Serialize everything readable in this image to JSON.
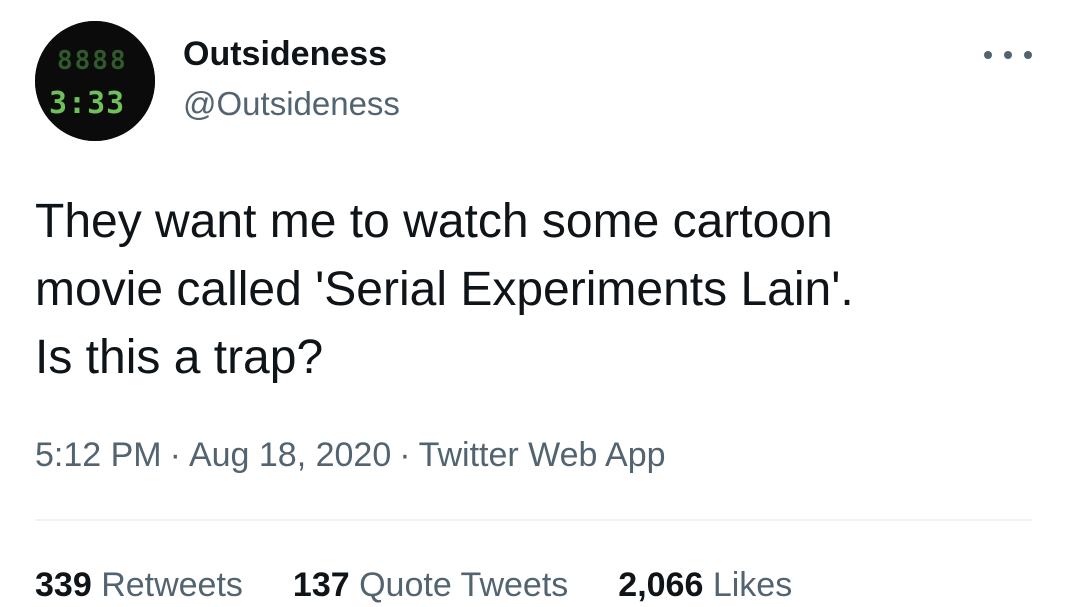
{
  "tweet": {
    "author": {
      "display_name": "Outsideness",
      "handle": "@Outsideness",
      "avatar": {
        "clock_text": "3:33",
        "clock_color": "#6fbf5a",
        "background": "#0b0b0b"
      }
    },
    "text_lines": [
      "They want me to watch some cartoon",
      "movie called 'Serial Experiments Lain'.",
      "Is this a trap?"
    ],
    "time": "5:12 PM",
    "date": "Aug 18, 2020",
    "source": "Twitter Web App",
    "separator": "·",
    "stats": {
      "retweets": {
        "count": "339",
        "label": "Retweets"
      },
      "quote_tweets": {
        "count": "137",
        "label": "Quote Tweets"
      },
      "likes": {
        "count": "2,066",
        "label": "Likes"
      }
    },
    "colors": {
      "primary_text": "#0f1419",
      "secondary_text": "#536471",
      "divider": "#eff3f4"
    }
  }
}
